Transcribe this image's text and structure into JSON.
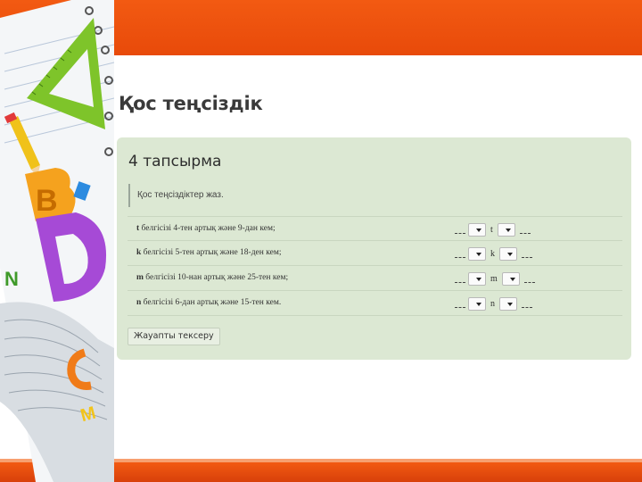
{
  "page": {
    "title": "Қос теңсіздік"
  },
  "task": {
    "title": "4 тапсырма",
    "instruction": "Қос теңсіздіктер жаз.",
    "rows": [
      {
        "variable": "t",
        "text": " белгісізі 4-тен артық және 9-дан кем;",
        "var_label": "t"
      },
      {
        "variable": "k",
        "text": " белгісізі 5-тен артық және 18-ден кем;",
        "var_label": "k"
      },
      {
        "variable": "m",
        "text": " белгісізі 10-нан артық және 25-тен кем;",
        "var_label": "m"
      },
      {
        "variable": "n",
        "text": " белгісізі 6-дан артық және 15-тен кем.",
        "var_label": "n"
      }
    ],
    "check_label": "Жауапты тексеру"
  },
  "icons": {
    "dropdown": "chevron-down-icon"
  },
  "colors": {
    "band": "#e84a0a",
    "panel": "#dce8d3"
  }
}
